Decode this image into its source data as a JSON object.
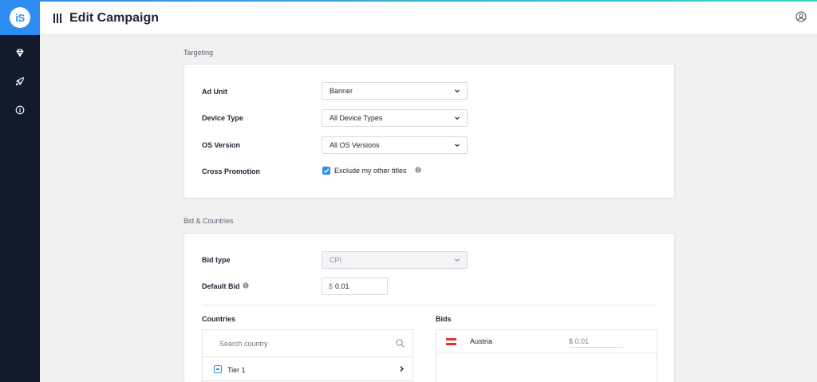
{
  "app": {
    "logo_text": "iS",
    "page_title": "Edit Campaign"
  },
  "sidebar": {
    "items": [
      {
        "icon": "diamond-icon"
      },
      {
        "icon": "rocket-icon"
      },
      {
        "icon": "info-icon"
      }
    ]
  },
  "header": {
    "user_icon": "user-circle-icon"
  },
  "targeting": {
    "section_title": "Targeting",
    "ad_unit_label": "Ad Unit",
    "ad_unit_value": "Banner",
    "device_type_label": "Device Type",
    "device_type_value": "All Device Types",
    "os_version_label": "OS Version",
    "os_version_value": "All OS Versions",
    "cross_promotion_label": "Cross Promotion",
    "cross_promotion_checkbox_label": "Exclude my other titles",
    "cross_promotion_checked": true
  },
  "bid_countries": {
    "section_title": "Bid & Countries",
    "bid_type_label": "Bid type",
    "bid_type_value": "CPI",
    "default_bid_label": "Default Bid",
    "currency_symbol": "$",
    "default_bid_value": "0.01",
    "countries_title": "Countries",
    "bids_title": "Bids",
    "search_placeholder": "Search country",
    "tiers": [
      {
        "label": "Tier 1"
      }
    ],
    "bids": [
      {
        "country": "Austria",
        "value": "$ 0.01"
      }
    ]
  },
  "colors": {
    "accent": "#2f8cf0",
    "sidebar_bg": "#121b2b",
    "austria_red": "#e3342f"
  }
}
